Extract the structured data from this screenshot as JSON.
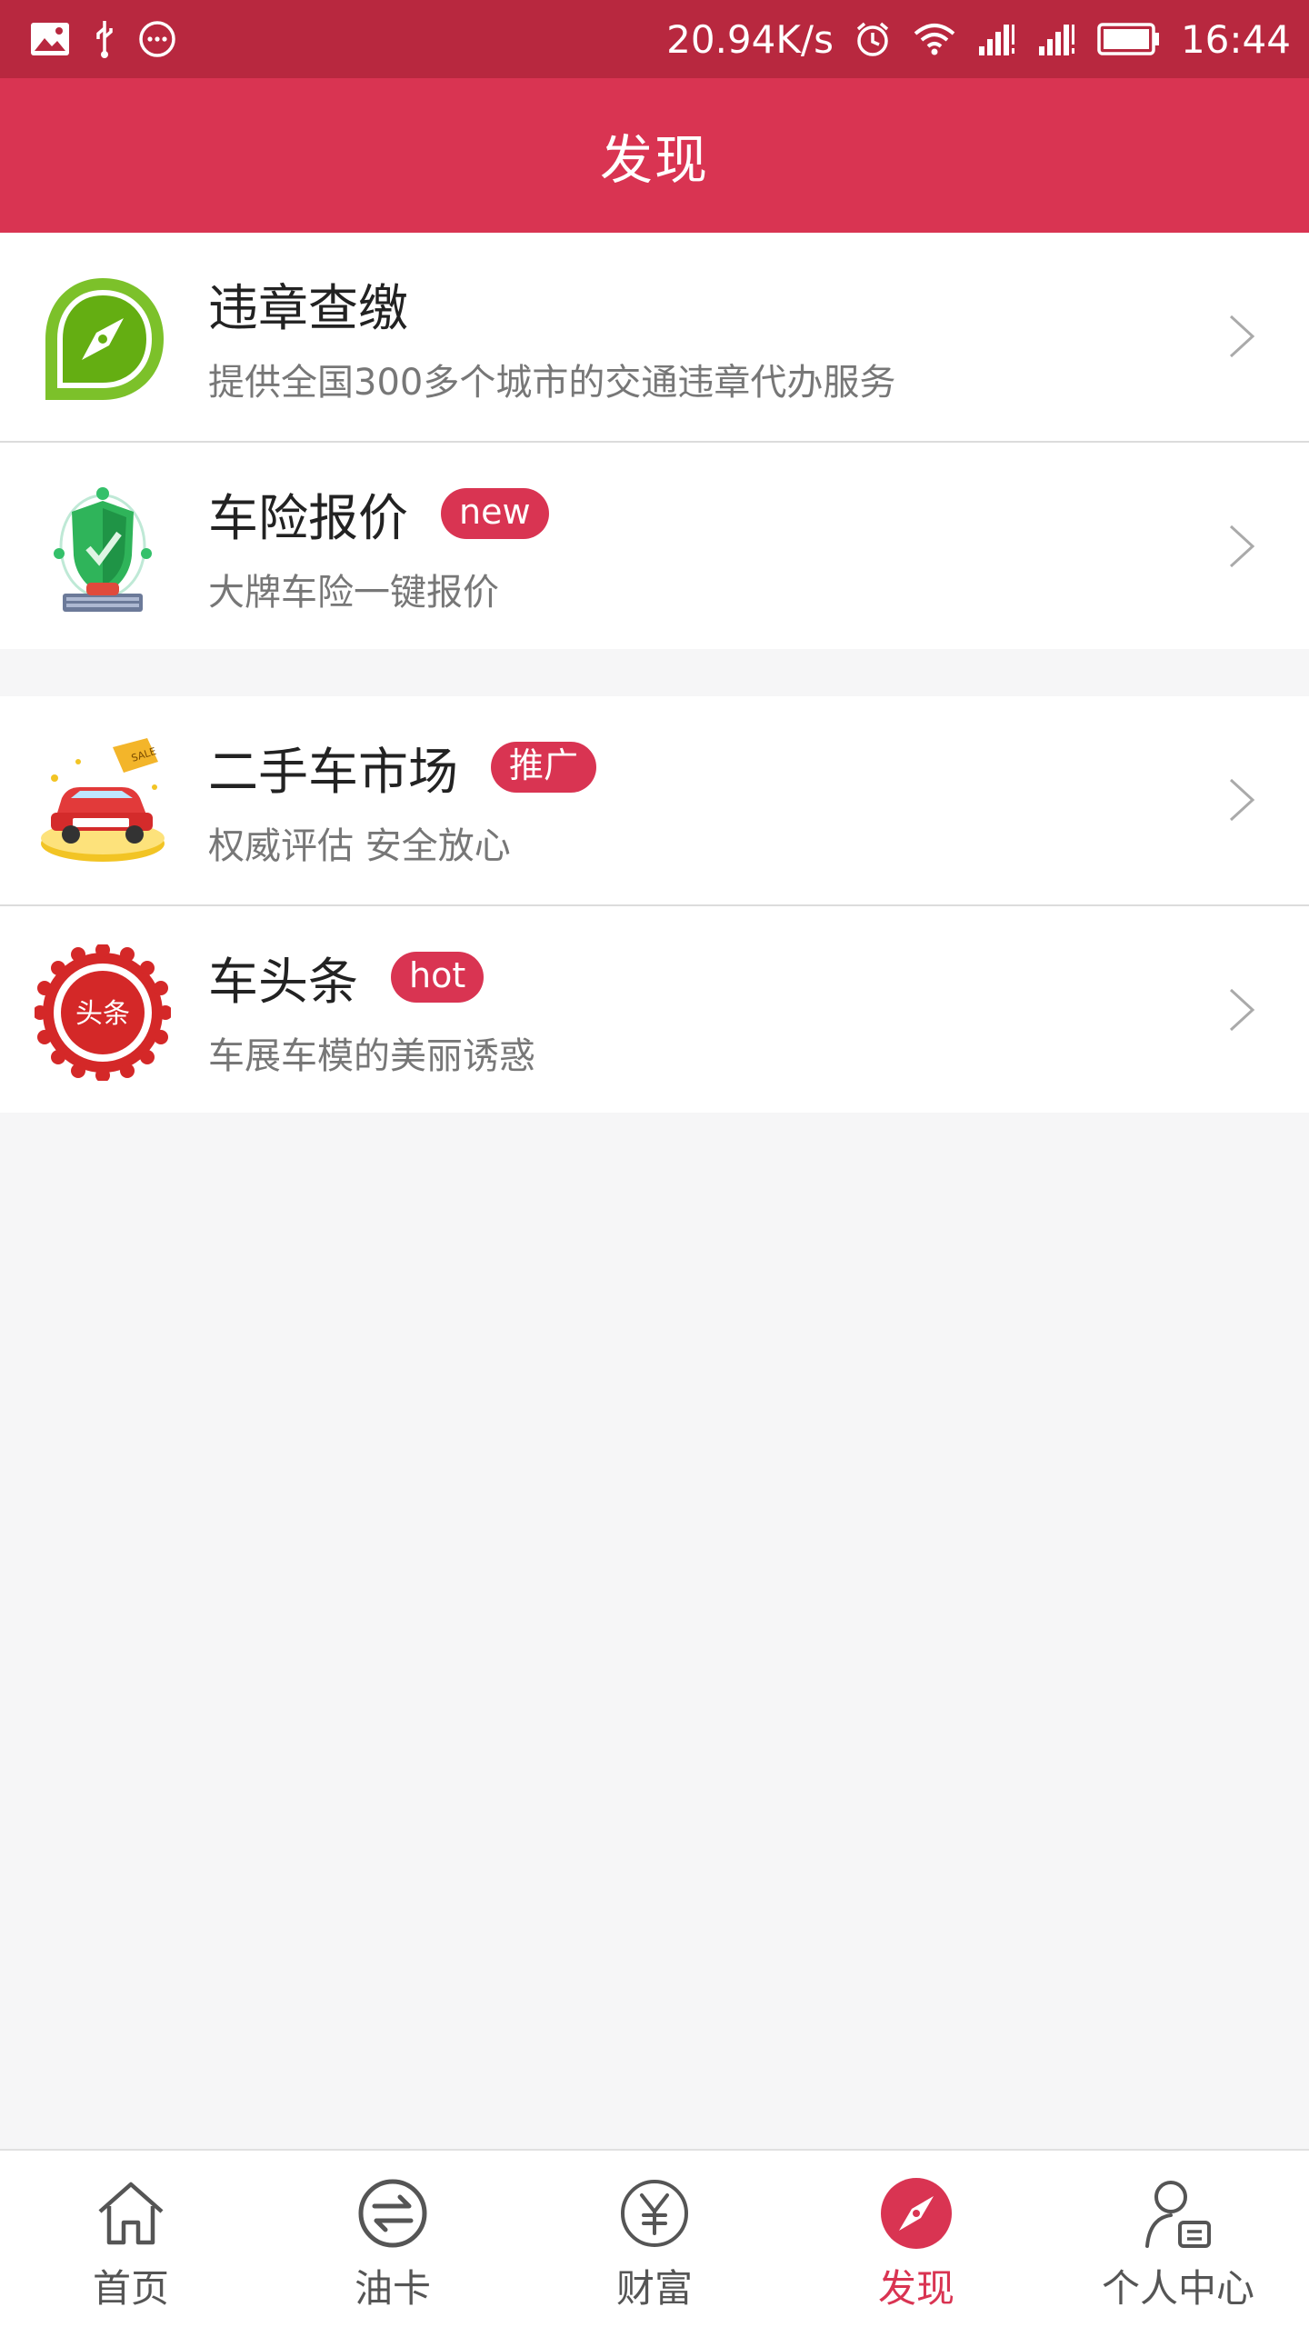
{
  "status_bar": {
    "speed": "20.94K/s",
    "time": "16:44",
    "icons": [
      "image-icon",
      "usb-icon",
      "more-icon",
      "alarm-icon",
      "wifi-icon",
      "signal-icon",
      "signal-icon",
      "battery-icon"
    ]
  },
  "header": {
    "title": "发现"
  },
  "groups": [
    {
      "items": [
        {
          "title": "违章查缴",
          "subtitle": "提供全国300多个城市的交通违章代办服务",
          "badge": "",
          "icon": "compass-icon"
        },
        {
          "title": "车险报价",
          "subtitle": "大牌车险一键报价",
          "badge": "new",
          "icon": "insurance-shield-icon"
        }
      ]
    },
    {
      "items": [
        {
          "title": "二手车市场",
          "subtitle": "权威评估 安全放心",
          "badge": "推广",
          "icon": "used-car-icon"
        },
        {
          "title": "车头条",
          "subtitle": "车展车模的美丽诱惑",
          "badge": "hot",
          "icon": "headline-seal-icon",
          "icon_text": "头条"
        }
      ]
    }
  ],
  "tabbar": {
    "tabs": [
      {
        "label": "首页",
        "icon": "home-icon",
        "active": false
      },
      {
        "label": "油卡",
        "icon": "exchange-icon",
        "active": false
      },
      {
        "label": "财富",
        "icon": "yen-icon",
        "active": false
      },
      {
        "label": "发现",
        "icon": "compass-icon",
        "active": true
      },
      {
        "label": "个人中心",
        "icon": "profile-icon",
        "active": false
      }
    ]
  },
  "colors": {
    "status_bar": "#b8283f",
    "primary": "#d93452",
    "background": "#f6f6f7",
    "badge": "#d93452"
  }
}
